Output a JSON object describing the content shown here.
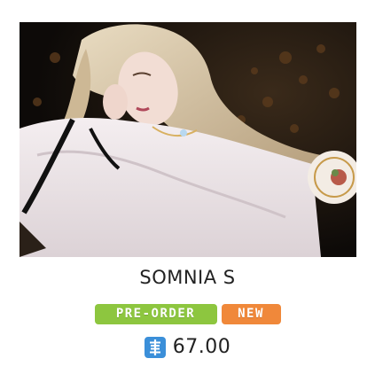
{
  "product": {
    "image_alt": "Somnia S doll photo",
    "name": "SOMNIA S",
    "price": "67.00",
    "currency_icon": "currency-icon"
  },
  "badges": [
    {
      "label": "PRE-ORDER",
      "color": "#8dc63f"
    },
    {
      "label": "NEW",
      "color": "#f0883a"
    }
  ],
  "colors": {
    "currency_icon": "#3b8fd9",
    "text": "#222222"
  }
}
